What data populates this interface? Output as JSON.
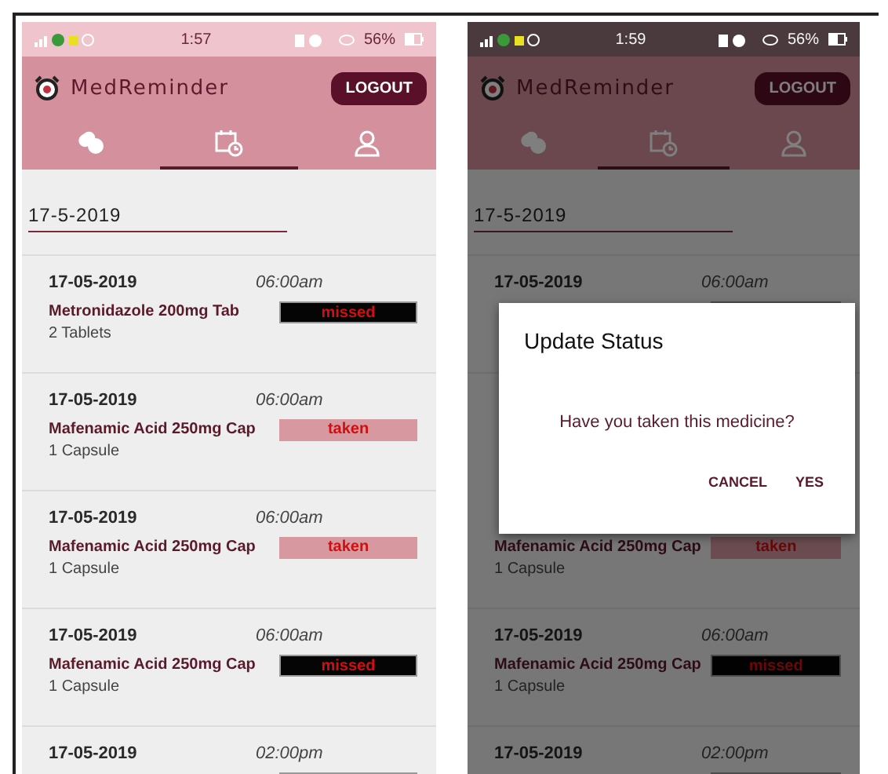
{
  "screens": [
    {
      "status_bar": {
        "time": "1:57",
        "battery": "56%"
      },
      "app_bar": {
        "title": "MedReminder",
        "logout": "LOGOUT"
      },
      "tabs": [
        {
          "kind": "pills",
          "selected": false
        },
        {
          "kind": "calendar",
          "selected": true
        },
        {
          "kind": "profile",
          "selected": false
        }
      ],
      "date_header": "17-5-2019",
      "entries": [
        {
          "date": "17-05-2019",
          "time": "06:00am",
          "medicine": "Metronidazole 200mg Tab",
          "dose": "2 Tablets",
          "status": {
            "kind": "missed",
            "label": "missed"
          }
        },
        {
          "date": "17-05-2019",
          "time": "06:00am",
          "medicine": "Mafenamic Acid 250mg Cap",
          "dose": "1 Capsule",
          "status": {
            "kind": "taken",
            "label": "taken"
          }
        },
        {
          "date": "17-05-2019",
          "time": "06:00am",
          "medicine": "Mafenamic Acid 250mg Cap",
          "dose": "1 Capsule",
          "status": {
            "kind": "taken",
            "label": "taken"
          }
        },
        {
          "date": "17-05-2019",
          "time": "06:00am",
          "medicine": "Mafenamic Acid 250mg Cap",
          "dose": "1 Capsule",
          "status": {
            "kind": "missed",
            "label": "missed"
          }
        },
        {
          "date": "17-05-2019",
          "time": "02:00pm",
          "status": {
            "kind": "missed"
          }
        }
      ]
    },
    {
      "status_bar": {
        "time": "1:59",
        "battery": "56%"
      },
      "app_bar": {
        "title": "MedReminder",
        "logout": "LOGOUT"
      },
      "tabs": [
        {
          "kind": "pills",
          "selected": false
        },
        {
          "kind": "calendar",
          "selected": true
        },
        {
          "kind": "profile",
          "selected": false
        }
      ],
      "date_header": "17-5-2019",
      "entries": [
        {
          "date": "17-05-2019",
          "time": "06:00am",
          "status": {
            "kind": "missed"
          }
        },
        {
          "medicine": "Mafenamic Acid 250mg Cap",
          "dose": "1 Capsule",
          "status": {
            "kind": "taken",
            "label": "taken"
          }
        },
        {
          "date": "17-05-2019",
          "time": "06:00am",
          "medicine": "Mafenamic Acid 250mg Cap",
          "dose": "1 Capsule",
          "status": {
            "kind": "missed",
            "label": "missed"
          }
        },
        {
          "date": "17-05-2019",
          "time": "02:00pm",
          "status": {
            "kind": "missed"
          }
        }
      ],
      "dialog": {
        "title": "Update Status",
        "message": "Have you taken this medicine?",
        "buttons": [
          "CANCEL",
          "YES"
        ]
      }
    }
  ]
}
